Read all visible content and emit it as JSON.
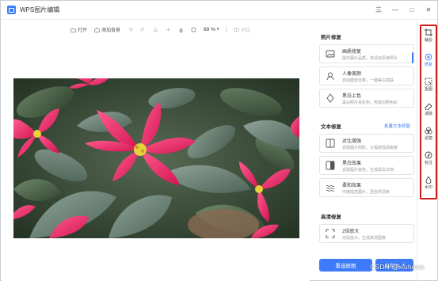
{
  "app": {
    "title": "WPS图片编辑"
  },
  "window_controls": {
    "menu": "三",
    "minimize": "—",
    "maximize": "□",
    "close": "✕"
  },
  "toolbar": {
    "open_label": "打开",
    "add_bg_label": "添加背景",
    "zoom": "69 %",
    "compare_label": "对比"
  },
  "panel": {
    "photo_repair": {
      "title": "照片修复",
      "items": [
        {
          "name": "画质修复",
          "desc": "提升图片品质，高清还原老照片"
        },
        {
          "name": "人像美颜",
          "desc": "自动磨皮效果，一键美白亮肤"
        },
        {
          "name": "黑白上色",
          "desc": "黑白照片变彩色，恢复旧照色彩"
        }
      ]
    },
    "text_repair": {
      "title": "文本修复",
      "link": "批量文本修复",
      "items": [
        {
          "name": "对比增强",
          "desc": "去除图片阴影，大幅增强清晰度"
        },
        {
          "name": "黑白效果",
          "desc": "去除图片底色，生成黑白文档"
        },
        {
          "name": "柔和效果",
          "desc": "中度提亮图片，更自然清晰"
        }
      ]
    },
    "hd_repair": {
      "title": "高清修复",
      "items": [
        {
          "name": "2倍放大",
          "desc": "无损放大，生成高清图像"
        }
      ]
    },
    "buttons": {
      "redo": "重选原图",
      "save_as": "另存为"
    }
  },
  "tools": [
    {
      "label": "裁剪",
      "icon": "crop-icon"
    },
    {
      "label": "修复",
      "icon": "repair-icon"
    },
    {
      "label": "抠图",
      "icon": "cutout-icon"
    },
    {
      "label": "消除",
      "icon": "eraser-icon"
    },
    {
      "label": "滤镜",
      "icon": "filter-icon"
    },
    {
      "label": "标注",
      "icon": "annotate-icon"
    },
    {
      "label": "水印",
      "icon": "watermark-icon"
    }
  ],
  "watermark": "CSDN @xiuhewe",
  "colors": {
    "accent": "#3e7bfa",
    "highlight_box": "#d11a1a"
  }
}
